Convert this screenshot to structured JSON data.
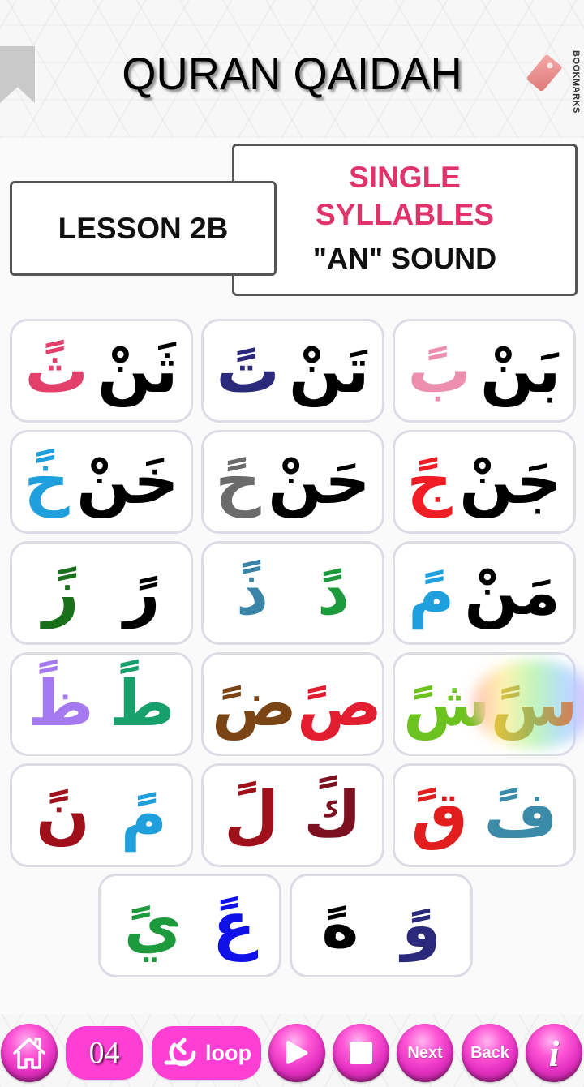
{
  "header": {
    "title": "QURAN QAIDAH",
    "bookmarks_label": "BOOKMARKS"
  },
  "lesson": {
    "label": "LESSON 2B",
    "topic_line1": "SINGLE",
    "topic_line2": "SYLLABLES",
    "topic_line3": "\"AN\" SOUND",
    "topic_color": "#e0336a"
  },
  "cards": [
    {
      "items": [
        {
          "text": "ثً",
          "color": "#e2406a"
        },
        {
          "text": "ثَنْ",
          "color": "#000000"
        }
      ]
    },
    {
      "items": [
        {
          "text": "تً",
          "color": "#2b2a7a"
        },
        {
          "text": "تَنْ",
          "color": "#000000"
        }
      ]
    },
    {
      "items": [
        {
          "text": "بً",
          "color": "#ec8fae"
        },
        {
          "text": "بَنْ",
          "color": "#000000"
        }
      ]
    },
    {
      "items": [
        {
          "text": "خً",
          "color": "#1fa0dc"
        },
        {
          "text": "خَنْ",
          "color": "#000000"
        }
      ]
    },
    {
      "items": [
        {
          "text": "حً",
          "color": "#6b6b6b"
        },
        {
          "text": "حَنْ",
          "color": "#000000"
        }
      ]
    },
    {
      "items": [
        {
          "text": "جً",
          "color": "#f01d25"
        },
        {
          "text": "جَنْ",
          "color": "#000000"
        }
      ]
    },
    {
      "items": [
        {
          "text": "زً",
          "color": "#1a6f1a"
        },
        {
          "text": "رً",
          "color": "#000000"
        }
      ]
    },
    {
      "items": [
        {
          "text": "ذً",
          "color": "#3a84a8"
        },
        {
          "text": "دً",
          "color": "#1c9a3c"
        }
      ]
    },
    {
      "items": [
        {
          "text": "مً",
          "color": "#1fa0dc"
        },
        {
          "text": "مَنْ",
          "color": "#000000"
        }
      ]
    },
    {
      "items": [
        {
          "text": "ظً",
          "color": "#a57af0"
        },
        {
          "text": "طً",
          "color": "#17a06c"
        }
      ]
    },
    {
      "items": [
        {
          "text": "ضً",
          "color": "#7a4414"
        },
        {
          "text": "صً",
          "color": "#e21d30"
        }
      ]
    },
    {
      "items": [
        {
          "text": "شً",
          "color": "#6cc21e"
        },
        {
          "text": "سً",
          "color": "rainbow"
        }
      ]
    },
    {
      "items": [
        {
          "text": "نً",
          "color": "#a0101a"
        },
        {
          "text": "مً",
          "color": "#1fa0dc"
        }
      ]
    },
    {
      "items": [
        {
          "text": "لً",
          "color": "#a0101a"
        },
        {
          "text": "كً",
          "color": "#7a1020"
        }
      ]
    },
    {
      "items": [
        {
          "text": "قً",
          "color": "#e21d1d"
        },
        {
          "text": "فً",
          "color": "#3a8aa8"
        }
      ]
    },
    {
      "items": [
        {
          "text": "يً",
          "color": "#1c9a3c"
        },
        {
          "text": "عً",
          "color": "#1010e8"
        }
      ]
    },
    {
      "items": [
        {
          "text": "هً",
          "color": "#000000"
        },
        {
          "text": "وً",
          "color": "#2b2a7a"
        }
      ]
    }
  ],
  "toolbar": {
    "accent_color": "#ff3ed4",
    "home_icon": "home-icon",
    "page_number": "04",
    "loop_label": "loop",
    "play_icon": "play-icon",
    "stop_icon": "stop-icon",
    "next_label": "Next",
    "back_label": "Back",
    "info_label": "i"
  }
}
